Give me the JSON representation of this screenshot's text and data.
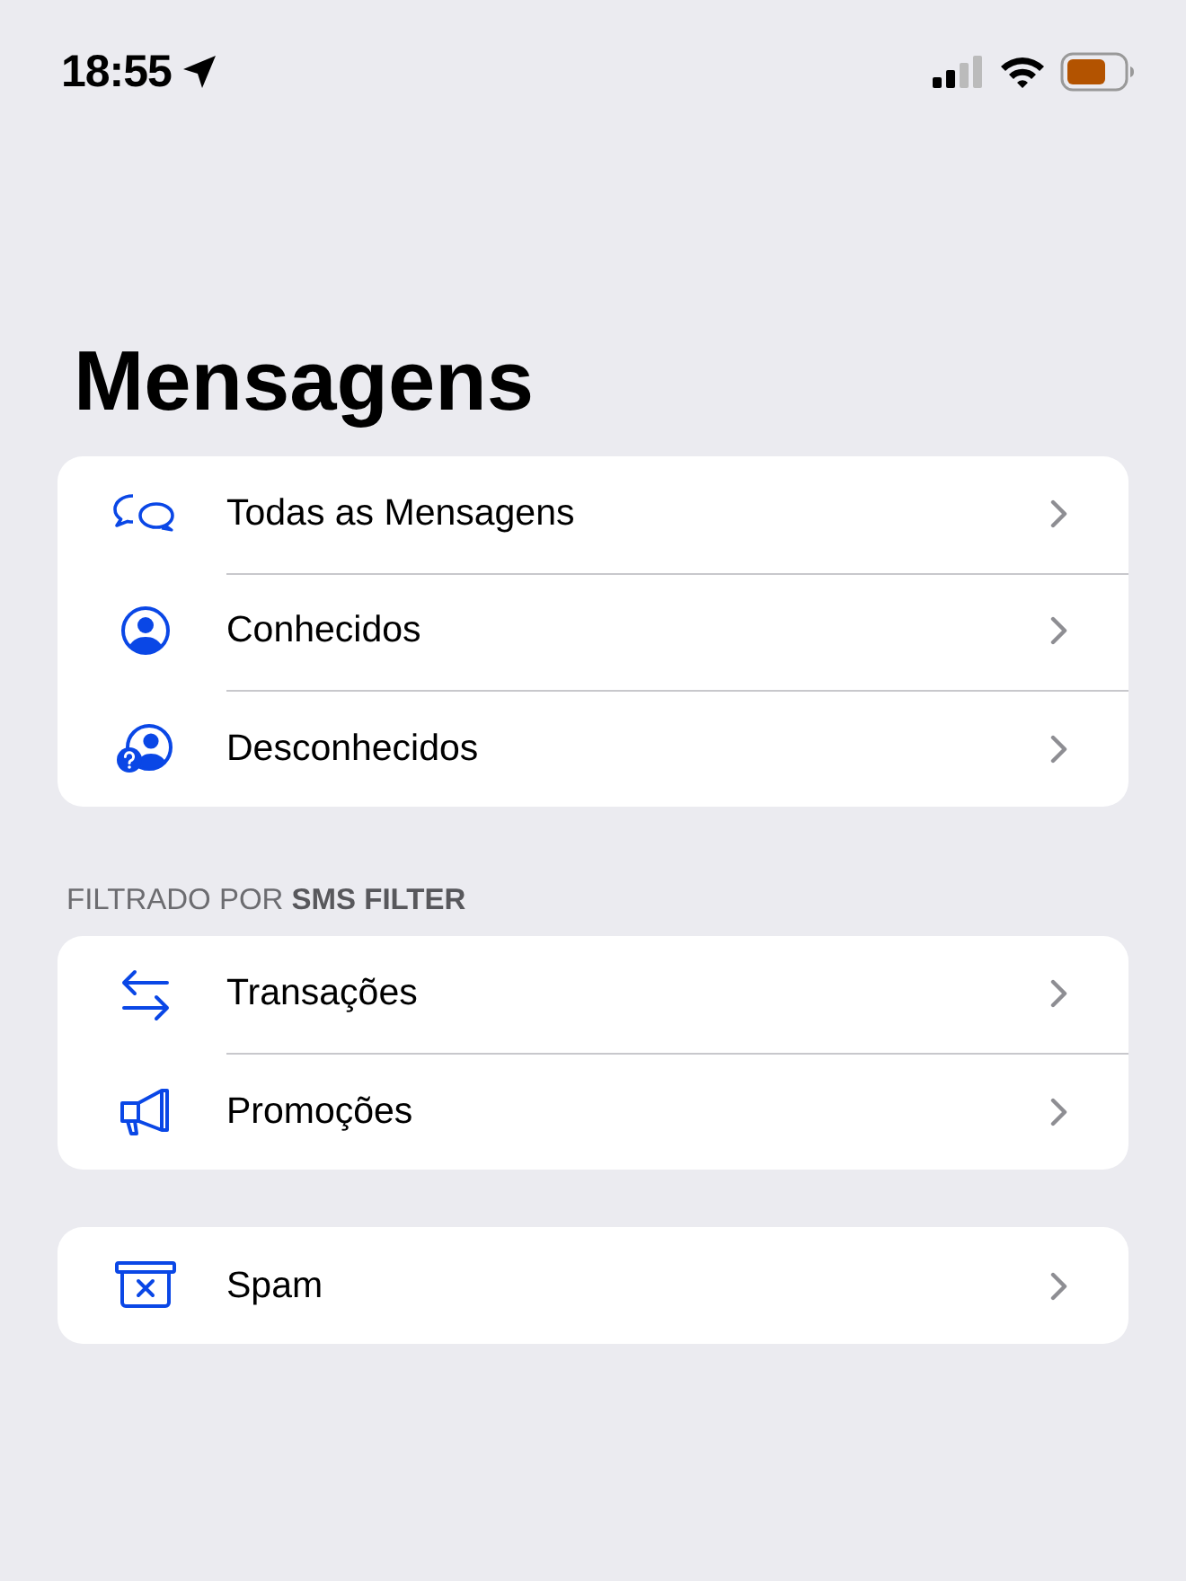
{
  "status_bar": {
    "time": "18:55"
  },
  "title": "Mensagens",
  "sections": [
    {
      "items": [
        {
          "label": "Todas as Mensagens"
        },
        {
          "label": "Conhecidos"
        },
        {
          "label": "Desconhecidos"
        }
      ]
    },
    {
      "header": "FILTRADO POR **SMS FILTER**",
      "items": [
        {
          "label": "Transações"
        },
        {
          "label": "Promoções"
        }
      ]
    },
    {
      "items": [
        {
          "label": "Spam"
        }
      ]
    }
  ]
}
